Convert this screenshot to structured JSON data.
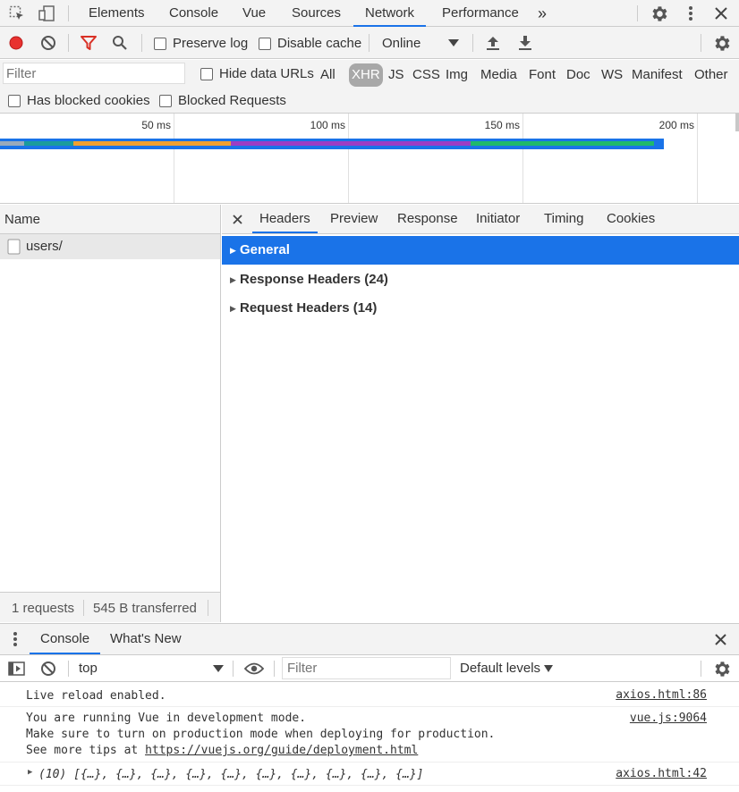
{
  "tabs": [
    "Elements",
    "Console",
    "Vue",
    "Sources",
    "Network",
    "Performance"
  ],
  "more_tabs": "»",
  "toolbar": {
    "preserve_log": "Preserve log",
    "disable_cache": "Disable cache",
    "throttle": "Online"
  },
  "filter": {
    "placeholder": "Filter",
    "hide_data_urls": "Hide data URLs",
    "types": [
      "All",
      "XHR",
      "JS",
      "CSS",
      "Img",
      "Media",
      "Font",
      "Doc",
      "WS",
      "Manifest",
      "Other"
    ],
    "selected_type": "XHR",
    "has_blocked_cookies": "Has blocked cookies",
    "blocked_requests": "Blocked Requests"
  },
  "timeline": {
    "ticks": [
      "50 ms",
      "100 ms",
      "150 ms",
      "200 ms"
    ]
  },
  "requests": {
    "header": "Name",
    "items": [
      "users/"
    ],
    "status_requests": "1 requests",
    "status_transferred": "545 B transferred"
  },
  "detail": {
    "tabs": [
      "Headers",
      "Preview",
      "Response",
      "Initiator",
      "Timing",
      "Cookies"
    ],
    "sections": [
      "General",
      "Response Headers (24)",
      "Request Headers (14)"
    ]
  },
  "drawer": {
    "tabs": [
      "Console",
      "What's New"
    ],
    "context": "top",
    "filter_placeholder": "Filter",
    "levels": "Default levels"
  },
  "console": {
    "messages": [
      {
        "lines": [
          "Live reload enabled."
        ],
        "source": "axios.html:86"
      },
      {
        "lines": [
          "You are running Vue in development mode.",
          "Make sure to turn on production mode when deploying for production."
        ],
        "tip_prefix": "See more tips at ",
        "tip_link": "https://vuejs.org/guide/deployment.html",
        "source": "vue.js:9064"
      },
      {
        "lines": [
          "(10) [{…}, {…}, {…}, {…}, {…}, {…}, {…}, {…}, {…}, {…}]"
        ],
        "source": "axios.html:42"
      }
    ]
  },
  "colors": {
    "accent": "#1a73e8",
    "record": "#e8312f",
    "filter_icon": "#d93025",
    "waterfall_orange": "#f0a030",
    "waterfall_purple": "#9c3dc4",
    "waterfall_green": "#1fb96b",
    "waterfall_teal": "#1a9c9c"
  }
}
